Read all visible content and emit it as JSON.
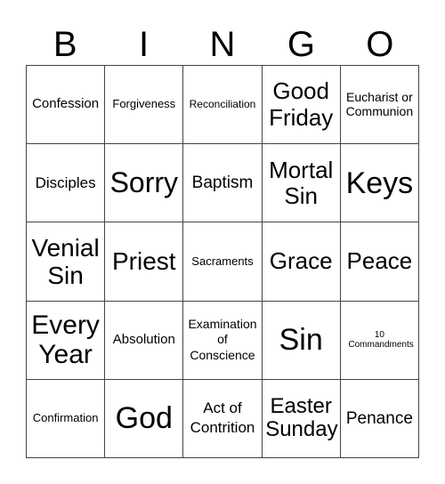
{
  "header": {
    "letters": [
      "B",
      "I",
      "N",
      "G",
      "O"
    ]
  },
  "board": {
    "rows": [
      [
        "Confession",
        "Forgiveness",
        "Reconciliation",
        "Good Friday",
        "Eucharist or Communion"
      ],
      [
        "Disciples",
        "Sorry",
        "Baptism",
        "Mortal Sin",
        "Keys"
      ],
      [
        "Venial Sin",
        "Priest",
        "Sacraments",
        "Grace",
        "Peace"
      ],
      [
        "Every Year",
        "Absolution",
        "Examination of Conscience",
        "Sin",
        "10 Commandments"
      ],
      [
        "Confirmation",
        "God",
        "Act of Contrition",
        "Easter Sunday",
        "Penance"
      ]
    ]
  }
}
